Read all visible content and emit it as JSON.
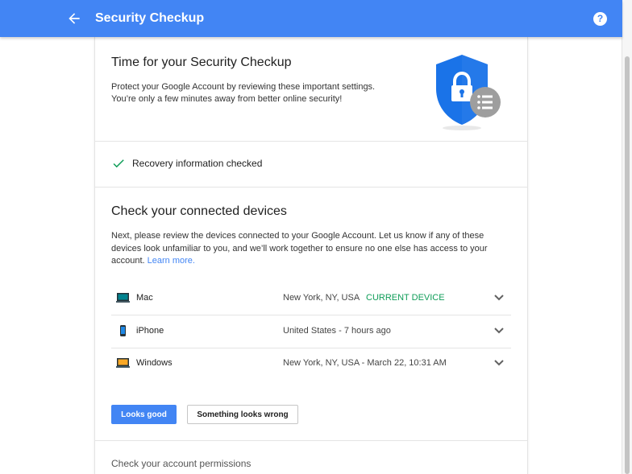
{
  "topbar": {
    "title": "Security Checkup",
    "back_icon": "arrow-left-icon",
    "help_icon": "help-circle-icon",
    "help_glyph": "?"
  },
  "intro": {
    "title": "Time for your Security Checkup",
    "description": "Protect your Google Account by reviewing these important settings. You’re only a few minutes away from better online security!",
    "illustration": "shield-lock-icon"
  },
  "recovery": {
    "icon": "check-icon",
    "text": "Recovery information checked"
  },
  "devices": {
    "title": "Check your connected devices",
    "description": "Next, please review the devices connected to your Google Account. Let us know if any of these devices look unfamiliar to you, and we’ll work together to ensure no one else has access to your account.",
    "learn_more": "Learn more.",
    "items": [
      {
        "name": "Mac",
        "location": "New York, NY, USA",
        "badge": "CURRENT DEVICE",
        "icon": "laptop-icon"
      },
      {
        "name": "iPhone",
        "location": "United States - 7 hours ago",
        "icon": "phone-icon"
      },
      {
        "name": "Windows",
        "location": "New York, NY, USA - March 22, 10:31 AM",
        "icon": "laptop-icon"
      }
    ],
    "looks_good": "Looks good",
    "something_wrong": "Something looks wrong"
  },
  "permissions": {
    "title": "Check your account permissions"
  },
  "colors": {
    "brand": "#4285f4",
    "success": "#0f9d58",
    "shield": "#1a73e8"
  }
}
